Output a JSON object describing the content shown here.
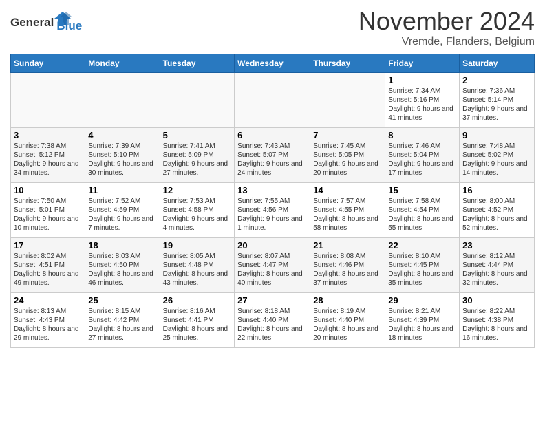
{
  "header": {
    "logo_line1": "General",
    "logo_line2": "Blue",
    "title": "November 2024",
    "location": "Vremde, Flanders, Belgium"
  },
  "calendar": {
    "days_of_week": [
      "Sunday",
      "Monday",
      "Tuesday",
      "Wednesday",
      "Thursday",
      "Friday",
      "Saturday"
    ],
    "weeks": [
      [
        {
          "day": "",
          "info": ""
        },
        {
          "day": "",
          "info": ""
        },
        {
          "day": "",
          "info": ""
        },
        {
          "day": "",
          "info": ""
        },
        {
          "day": "",
          "info": ""
        },
        {
          "day": "1",
          "info": "Sunrise: 7:34 AM\nSunset: 5:16 PM\nDaylight: 9 hours and 41 minutes."
        },
        {
          "day": "2",
          "info": "Sunrise: 7:36 AM\nSunset: 5:14 PM\nDaylight: 9 hours and 37 minutes."
        }
      ],
      [
        {
          "day": "3",
          "info": "Sunrise: 7:38 AM\nSunset: 5:12 PM\nDaylight: 9 hours and 34 minutes."
        },
        {
          "day": "4",
          "info": "Sunrise: 7:39 AM\nSunset: 5:10 PM\nDaylight: 9 hours and 30 minutes."
        },
        {
          "day": "5",
          "info": "Sunrise: 7:41 AM\nSunset: 5:09 PM\nDaylight: 9 hours and 27 minutes."
        },
        {
          "day": "6",
          "info": "Sunrise: 7:43 AM\nSunset: 5:07 PM\nDaylight: 9 hours and 24 minutes."
        },
        {
          "day": "7",
          "info": "Sunrise: 7:45 AM\nSunset: 5:05 PM\nDaylight: 9 hours and 20 minutes."
        },
        {
          "day": "8",
          "info": "Sunrise: 7:46 AM\nSunset: 5:04 PM\nDaylight: 9 hours and 17 minutes."
        },
        {
          "day": "9",
          "info": "Sunrise: 7:48 AM\nSunset: 5:02 PM\nDaylight: 9 hours and 14 minutes."
        }
      ],
      [
        {
          "day": "10",
          "info": "Sunrise: 7:50 AM\nSunset: 5:01 PM\nDaylight: 9 hours and 10 minutes."
        },
        {
          "day": "11",
          "info": "Sunrise: 7:52 AM\nSunset: 4:59 PM\nDaylight: 9 hours and 7 minutes."
        },
        {
          "day": "12",
          "info": "Sunrise: 7:53 AM\nSunset: 4:58 PM\nDaylight: 9 hours and 4 minutes."
        },
        {
          "day": "13",
          "info": "Sunrise: 7:55 AM\nSunset: 4:56 PM\nDaylight: 9 hours and 1 minute."
        },
        {
          "day": "14",
          "info": "Sunrise: 7:57 AM\nSunset: 4:55 PM\nDaylight: 8 hours and 58 minutes."
        },
        {
          "day": "15",
          "info": "Sunrise: 7:58 AM\nSunset: 4:54 PM\nDaylight: 8 hours and 55 minutes."
        },
        {
          "day": "16",
          "info": "Sunrise: 8:00 AM\nSunset: 4:52 PM\nDaylight: 8 hours and 52 minutes."
        }
      ],
      [
        {
          "day": "17",
          "info": "Sunrise: 8:02 AM\nSunset: 4:51 PM\nDaylight: 8 hours and 49 minutes."
        },
        {
          "day": "18",
          "info": "Sunrise: 8:03 AM\nSunset: 4:50 PM\nDaylight: 8 hours and 46 minutes."
        },
        {
          "day": "19",
          "info": "Sunrise: 8:05 AM\nSunset: 4:48 PM\nDaylight: 8 hours and 43 minutes."
        },
        {
          "day": "20",
          "info": "Sunrise: 8:07 AM\nSunset: 4:47 PM\nDaylight: 8 hours and 40 minutes."
        },
        {
          "day": "21",
          "info": "Sunrise: 8:08 AM\nSunset: 4:46 PM\nDaylight: 8 hours and 37 minutes."
        },
        {
          "day": "22",
          "info": "Sunrise: 8:10 AM\nSunset: 4:45 PM\nDaylight: 8 hours and 35 minutes."
        },
        {
          "day": "23",
          "info": "Sunrise: 8:12 AM\nSunset: 4:44 PM\nDaylight: 8 hours and 32 minutes."
        }
      ],
      [
        {
          "day": "24",
          "info": "Sunrise: 8:13 AM\nSunset: 4:43 PM\nDaylight: 8 hours and 29 minutes."
        },
        {
          "day": "25",
          "info": "Sunrise: 8:15 AM\nSunset: 4:42 PM\nDaylight: 8 hours and 27 minutes."
        },
        {
          "day": "26",
          "info": "Sunrise: 8:16 AM\nSunset: 4:41 PM\nDaylight: 8 hours and 25 minutes."
        },
        {
          "day": "27",
          "info": "Sunrise: 8:18 AM\nSunset: 4:40 PM\nDaylight: 8 hours and 22 minutes."
        },
        {
          "day": "28",
          "info": "Sunrise: 8:19 AM\nSunset: 4:40 PM\nDaylight: 8 hours and 20 minutes."
        },
        {
          "day": "29",
          "info": "Sunrise: 8:21 AM\nSunset: 4:39 PM\nDaylight: 8 hours and 18 minutes."
        },
        {
          "day": "30",
          "info": "Sunrise: 8:22 AM\nSunset: 4:38 PM\nDaylight: 8 hours and 16 minutes."
        }
      ]
    ]
  }
}
